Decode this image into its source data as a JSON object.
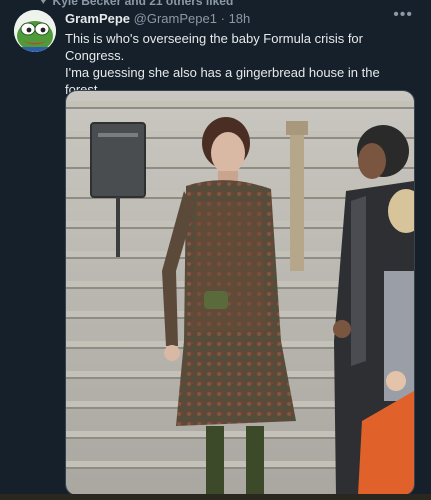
{
  "context": {
    "text": "Kyle Becker and 21 others liked"
  },
  "tweet": {
    "display_name": "GramPepe",
    "handle": "@GramPepe1",
    "separator": "·",
    "time": "18h",
    "text_line1": "This is who's overseeing the baby Formula crisis for Congress.",
    "text_line2": "I'ma guessing she also has a gingerbread house in the forest.",
    "more_icon": "more-options-icon"
  },
  "colors": {
    "background": "#15202b",
    "primary_text": "#e7e9ea",
    "secondary_text": "#8b98a5"
  }
}
